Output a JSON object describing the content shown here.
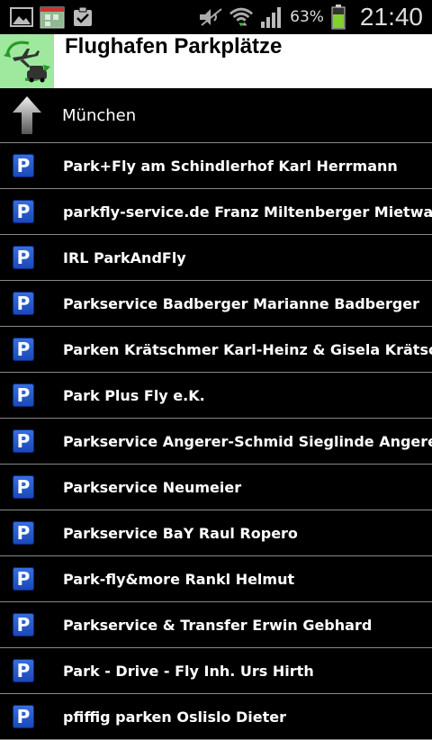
{
  "status_bar": {
    "battery_percent": "63%",
    "time": "21:40",
    "icons": [
      "gallery-icon",
      "calendar-icon",
      "clipboard-check-icon",
      "mute-icon",
      "wifi-icon",
      "signal-icon",
      "battery-icon"
    ]
  },
  "header": {
    "title": "Flughafen Parkplätze",
    "logo_icon": "airport-parking-logo-icon"
  },
  "navigation": {
    "up_icon": "up-arrow-icon",
    "city": "München"
  },
  "list": {
    "icon": "parking-icon",
    "icon_letter": "P",
    "items": [
      "Park+Fly am Schindlerhof Karl Herrmann",
      "parkfly-service.de Franz Miltenberger Mietwagenunternehmen",
      "IRL ParkAndFly",
      "Parkservice Badberger Marianne Badberger",
      "Parken Krätschmer Karl-Heinz & Gisela Krätschmer",
      "Park Plus Fly e.K.",
      "Parkservice Angerer-Schmid Sieglinde Angerer-Schmid",
      "Parkservice Neumeier",
      "Parkservice BaY Raul Ropero",
      "Park-fly&more Rankl Helmut",
      "Parkservice & Transfer Erwin Gebhard",
      "Park - Drive - Fly Inh. Urs Hirth",
      "pfiffig parken Oslislo Dieter"
    ]
  },
  "colors": {
    "background": "#000000",
    "header_bg": "#ffffff",
    "logo_bg": "#9ee99e",
    "parking_blue": "#1f56c8",
    "divider": "#888888"
  }
}
